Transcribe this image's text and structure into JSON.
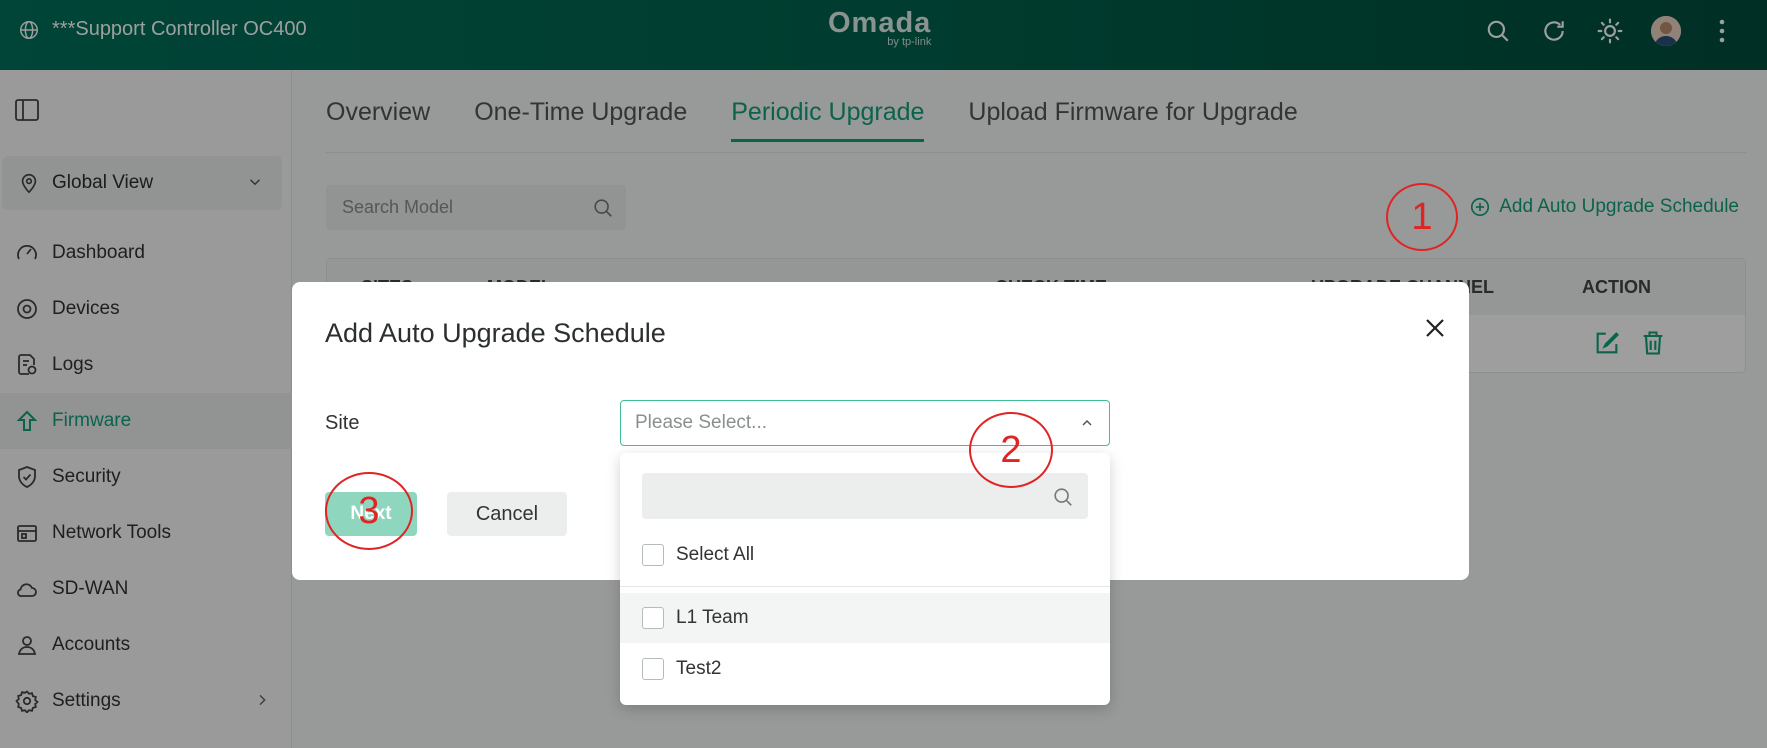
{
  "topbar": {
    "controller_name": "***Support Controller OC400",
    "brand": "Omada",
    "brand_sub": "by tp-link",
    "icons": [
      "search-icon",
      "refresh-icon",
      "theme-sun-icon",
      "avatar",
      "more-vertical-icon"
    ]
  },
  "sidebar": {
    "scope": "Global View",
    "items": [
      {
        "label": "Dashboard",
        "icon": "dashboard-icon"
      },
      {
        "label": "Devices",
        "icon": "devices-icon"
      },
      {
        "label": "Logs",
        "icon": "logs-icon"
      },
      {
        "label": "Firmware",
        "icon": "firmware-icon",
        "active": true
      },
      {
        "label": "Security",
        "icon": "shield-icon"
      },
      {
        "label": "Network Tools",
        "icon": "toolbox-icon"
      },
      {
        "label": "SD-WAN",
        "icon": "cloud-icon"
      },
      {
        "label": "Accounts",
        "icon": "user-icon"
      },
      {
        "label": "Settings",
        "icon": "gear-icon"
      }
    ]
  },
  "main": {
    "tabs": [
      "Overview",
      "One-Time Upgrade",
      "Periodic Upgrade",
      "Upload Firmware for Upgrade"
    ],
    "active_tab": "Periodic Upgrade",
    "search_placeholder": "Search Model",
    "add_link": "Add Auto Upgrade Schedule",
    "table_headers": [
      "SITES",
      "MODEL",
      "CHECK TIME",
      "UPGRADE CHANNEL",
      "ACTION"
    ]
  },
  "modal": {
    "title": "Add Auto Upgrade Schedule",
    "site_label": "Site",
    "select_placeholder": "Please Select...",
    "next": "Next",
    "cancel": "Cancel",
    "dropdown": {
      "select_all": "Select All",
      "options": [
        "L1 Team",
        "Test2"
      ]
    }
  },
  "annotations": [
    "1",
    "2",
    "3"
  ],
  "colors": {
    "accent": "#13a07a",
    "topbar": "#005a45",
    "annotation": "#e02424"
  }
}
